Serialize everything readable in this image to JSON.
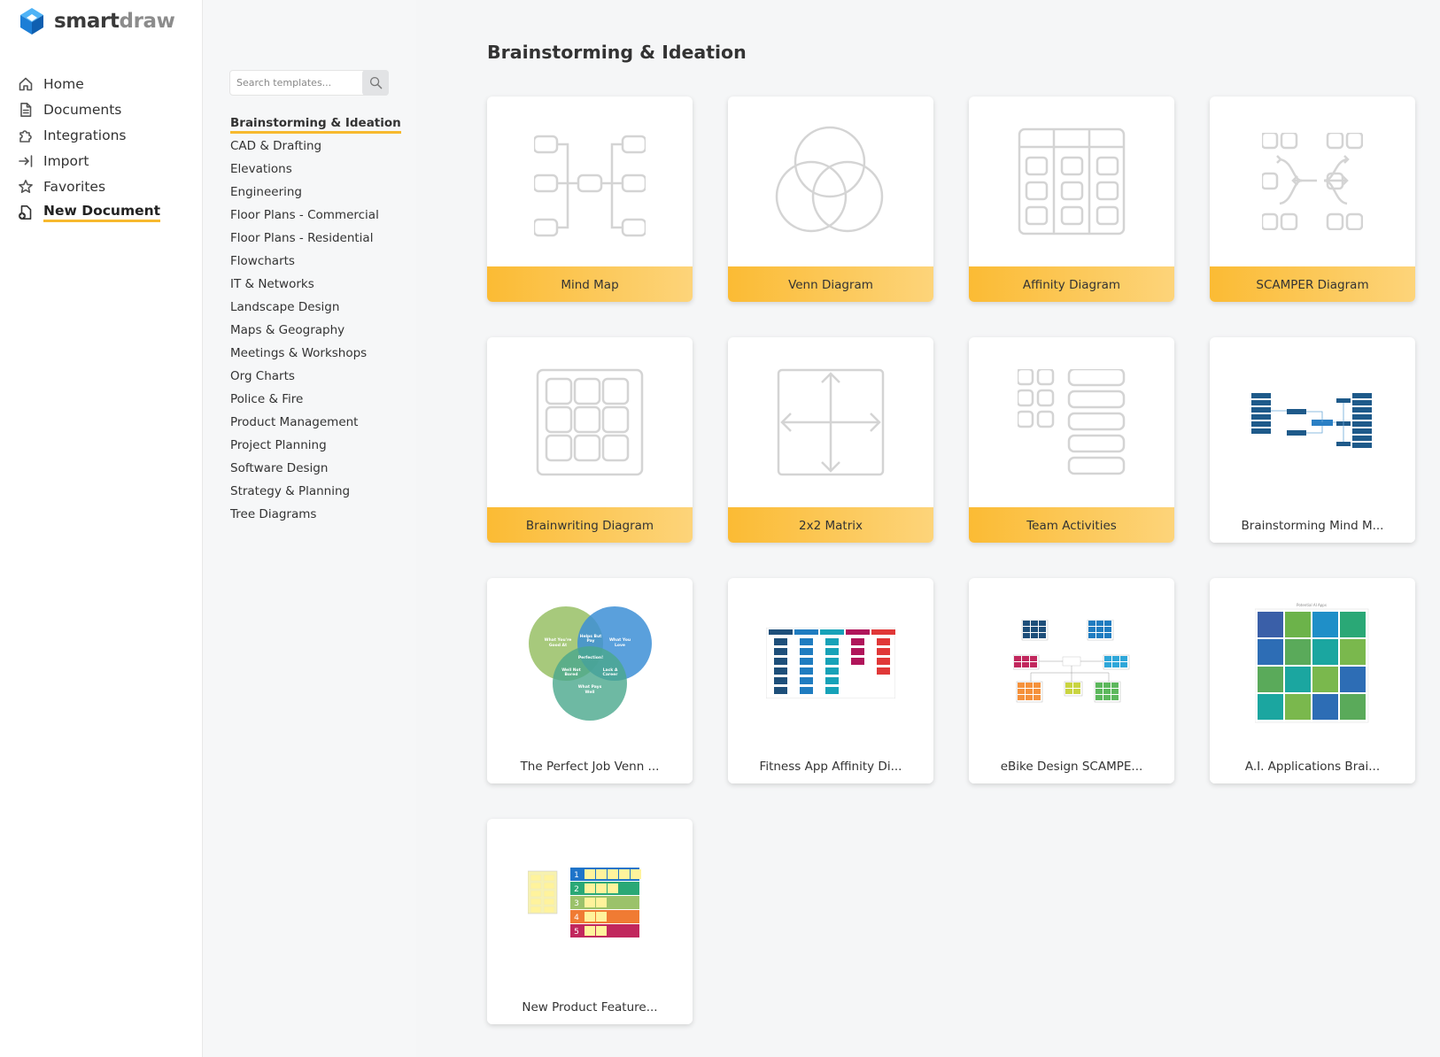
{
  "app": {
    "logo_smart": "smart",
    "logo_draw": "draw"
  },
  "nav": {
    "items": [
      {
        "label": "Home",
        "icon": "home-icon"
      },
      {
        "label": "Documents",
        "icon": "document-icon"
      },
      {
        "label": "Integrations",
        "icon": "integrations-icon"
      },
      {
        "label": "Import",
        "icon": "import-icon"
      },
      {
        "label": "Favorites",
        "icon": "star-icon"
      },
      {
        "label": "New Document",
        "icon": "new-document-icon",
        "active": true
      }
    ]
  },
  "search": {
    "placeholder": "Search templates..."
  },
  "categories": [
    "Brainstorming & Ideation",
    "CAD & Drafting",
    "Elevations",
    "Engineering",
    "Floor Plans - Commercial",
    "Floor Plans - Residential",
    "Flowcharts",
    "IT & Networks",
    "Landscape Design",
    "Maps & Geography",
    "Meetings & Workshops",
    "Org Charts",
    "Police & Fire",
    "Product Management",
    "Project Planning",
    "Software Design",
    "Strategy & Planning",
    "Tree Diagrams"
  ],
  "active_category": "Brainstorming & Ideation",
  "main": {
    "title": "Brainstorming & Ideation"
  },
  "templates": [
    {
      "label": "Mind Map",
      "kind": "blank",
      "thumb": "mindmap"
    },
    {
      "label": "Venn Diagram",
      "kind": "blank",
      "thumb": "venn"
    },
    {
      "label": "Affinity Diagram",
      "kind": "blank",
      "thumb": "affinity"
    },
    {
      "label": "SCAMPER Diagram",
      "kind": "blank",
      "thumb": "scamper"
    },
    {
      "label": "Brainwriting Diagram",
      "kind": "blank",
      "thumb": "brainwriting"
    },
    {
      "label": "2x2 Matrix",
      "kind": "blank",
      "thumb": "matrix"
    },
    {
      "label": "Team Activities",
      "kind": "blank",
      "thumb": "team"
    },
    {
      "label": "Brainstorming Mind M...",
      "kind": "example",
      "thumb": "ex-mindmap"
    },
    {
      "label": "The Perfect Job Venn ...",
      "kind": "example",
      "thumb": "ex-venn"
    },
    {
      "label": "Fitness App Affinity Di...",
      "kind": "example",
      "thumb": "ex-affinity"
    },
    {
      "label": "eBike Design SCAMPE...",
      "kind": "example",
      "thumb": "ex-scamper"
    },
    {
      "label": "A.I. Applications Brai...",
      "kind": "example",
      "thumb": "ex-ai"
    },
    {
      "label": "New Product Feature...",
      "kind": "example",
      "thumb": "ex-feature"
    }
  ],
  "colors": {
    "accent": "#f7b92e",
    "caption_gradient_start": "#fbbb34",
    "caption_gradient_end": "#fdd47a",
    "logo_blue": "#1c7ed6"
  }
}
